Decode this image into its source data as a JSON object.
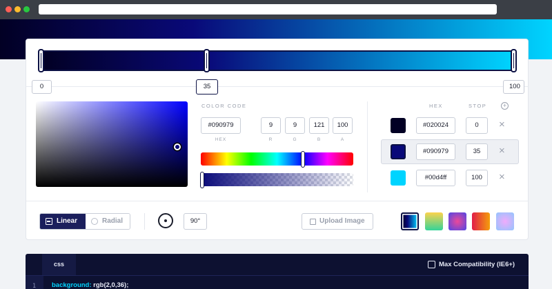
{
  "colors": {
    "stop1": "#020024",
    "stop2": "#090979",
    "stop3": "#00d4ff",
    "navy": "#0c1144",
    "chrome": "#3b3f46"
  },
  "gradient_bar": {
    "stops": [
      {
        "position": "0",
        "hex": "#020024",
        "stop": "0"
      },
      {
        "position": "35",
        "hex": "#090979",
        "stop": "35"
      },
      {
        "position": "100",
        "hex": "#00d4ff",
        "stop": "100"
      }
    ],
    "selected_index": 1
  },
  "picker": {
    "color_code_label": "COLOR CODE",
    "hex_value": "#090979",
    "r": "9",
    "g": "9",
    "b": "121",
    "a": "100",
    "cap_hex": "HEX",
    "cap_r": "R",
    "cap_g": "G",
    "cap_b": "B",
    "cap_a": "A",
    "hue_fraction": 0.67,
    "alpha_fraction": 0.0
  },
  "stops_table": {
    "col_hex": "HEX",
    "col_stop": "STOP",
    "add_icon": "plus-circle-icon",
    "rows": [
      {
        "hex": "#020024",
        "stop": "0",
        "remove": "×"
      },
      {
        "hex": "#090979",
        "stop": "35",
        "remove": "×"
      },
      {
        "hex": "#00d4ff",
        "stop": "100",
        "remove": "×"
      }
    ]
  },
  "toolbar": {
    "linear_label": "Linear",
    "radial_label": "Radial",
    "angle_value": "90°",
    "upload_label": "Upload Image",
    "active_type": "linear"
  },
  "presets": [
    {
      "from": "#020024",
      "via": "#090979",
      "to": "#00d4ff",
      "selected": true
    },
    {
      "from": "#fcd34d",
      "to": "#34d399",
      "selected": false
    },
    {
      "from": "#4f46e5",
      "to": "#ec4899",
      "selected": false
    },
    {
      "from": "#e11d48",
      "to": "#f59e0b",
      "selected": false
    },
    {
      "from": "#93c5fd",
      "to": "#f0abfc",
      "selected": false
    }
  ],
  "code_panel": {
    "tab_label": "css",
    "compat_label": "Max Compatibility (IE6+)",
    "line_number": "1",
    "property": "background:",
    "value": " rgb(2,0,36);"
  }
}
